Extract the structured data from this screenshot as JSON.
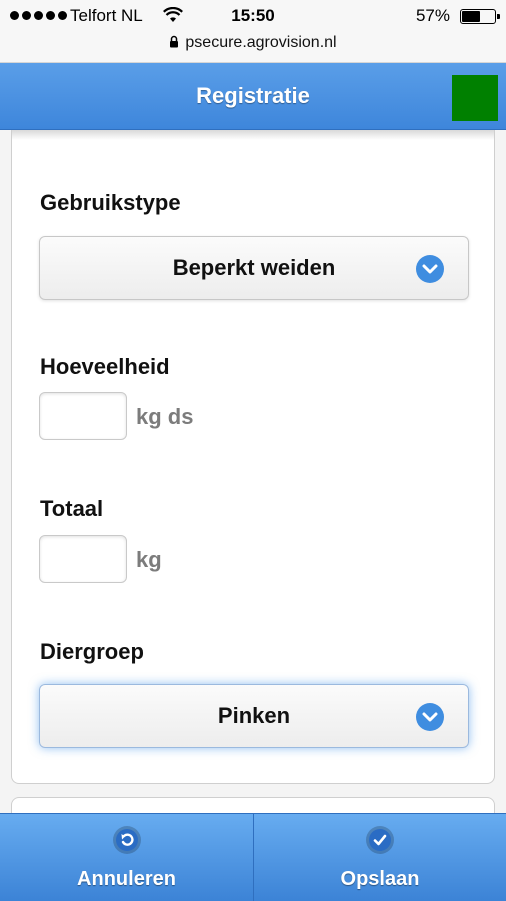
{
  "status_bar": {
    "carrier": "Telfort NL",
    "time": "15:50",
    "battery_percent": "57%",
    "battery_level": 0.57,
    "url": "psecure.agrovision.nl"
  },
  "header": {
    "title": "Registratie",
    "status_color": "#008000"
  },
  "form": {
    "gebruikstype": {
      "label": "Gebruikstype",
      "value": "Beperkt weiden"
    },
    "hoeveelheid": {
      "label": "Hoeveelheid",
      "value": "",
      "unit": "kg ds"
    },
    "totaal": {
      "label": "Totaal",
      "value": "",
      "unit": "kg"
    },
    "diergroep": {
      "label": "Diergroep",
      "value": "Pinken"
    }
  },
  "footer": {
    "cancel_label": "Annuleren",
    "save_label": "Opslaan"
  },
  "colors": {
    "accent": "#4a90e2",
    "header_title": "#ffffff",
    "unit_text": "#7c7c7c"
  }
}
